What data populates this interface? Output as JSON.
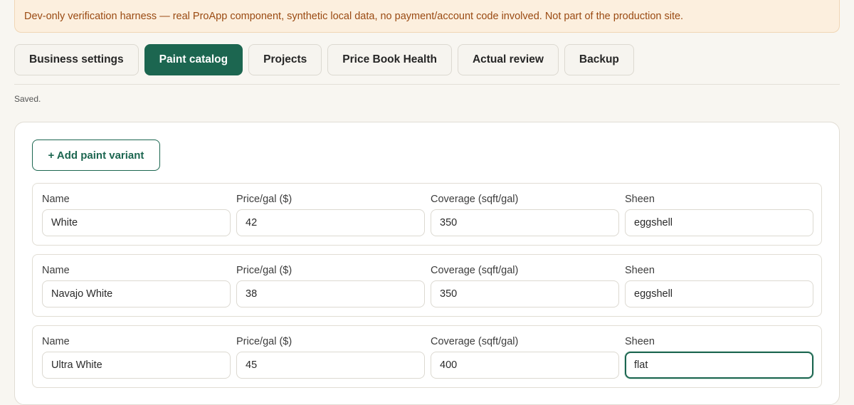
{
  "banner": {
    "text": "Dev-only verification harness — real ProApp component, synthetic local data, no payment/account code involved. Not part of the production site."
  },
  "tabs": [
    {
      "label": "Business settings",
      "active": false
    },
    {
      "label": "Paint catalog",
      "active": true
    },
    {
      "label": "Projects",
      "active": false
    },
    {
      "label": "Price Book Health",
      "active": false
    },
    {
      "label": "Actual review",
      "active": false
    },
    {
      "label": "Backup",
      "active": false
    }
  ],
  "status": "Saved.",
  "catalog": {
    "add_label": "+ Add paint variant",
    "labels": {
      "name": "Name",
      "price": "Price/gal ($)",
      "coverage": "Coverage (sqft/gal)",
      "sheen": "Sheen"
    },
    "variants": [
      {
        "name": "White",
        "price": "42",
        "coverage": "350",
        "sheen": "eggshell"
      },
      {
        "name": "Navajo White",
        "price": "38",
        "coverage": "350",
        "sheen": "eggshell"
      },
      {
        "name": "Ultra White",
        "price": "45",
        "coverage": "400",
        "sheen": "flat"
      }
    ],
    "focused_field": "variants.2.sheen"
  },
  "colors": {
    "accent": "#1c6650",
    "banner_bg": "#fcefde",
    "banner_text": "#9a4a12"
  }
}
